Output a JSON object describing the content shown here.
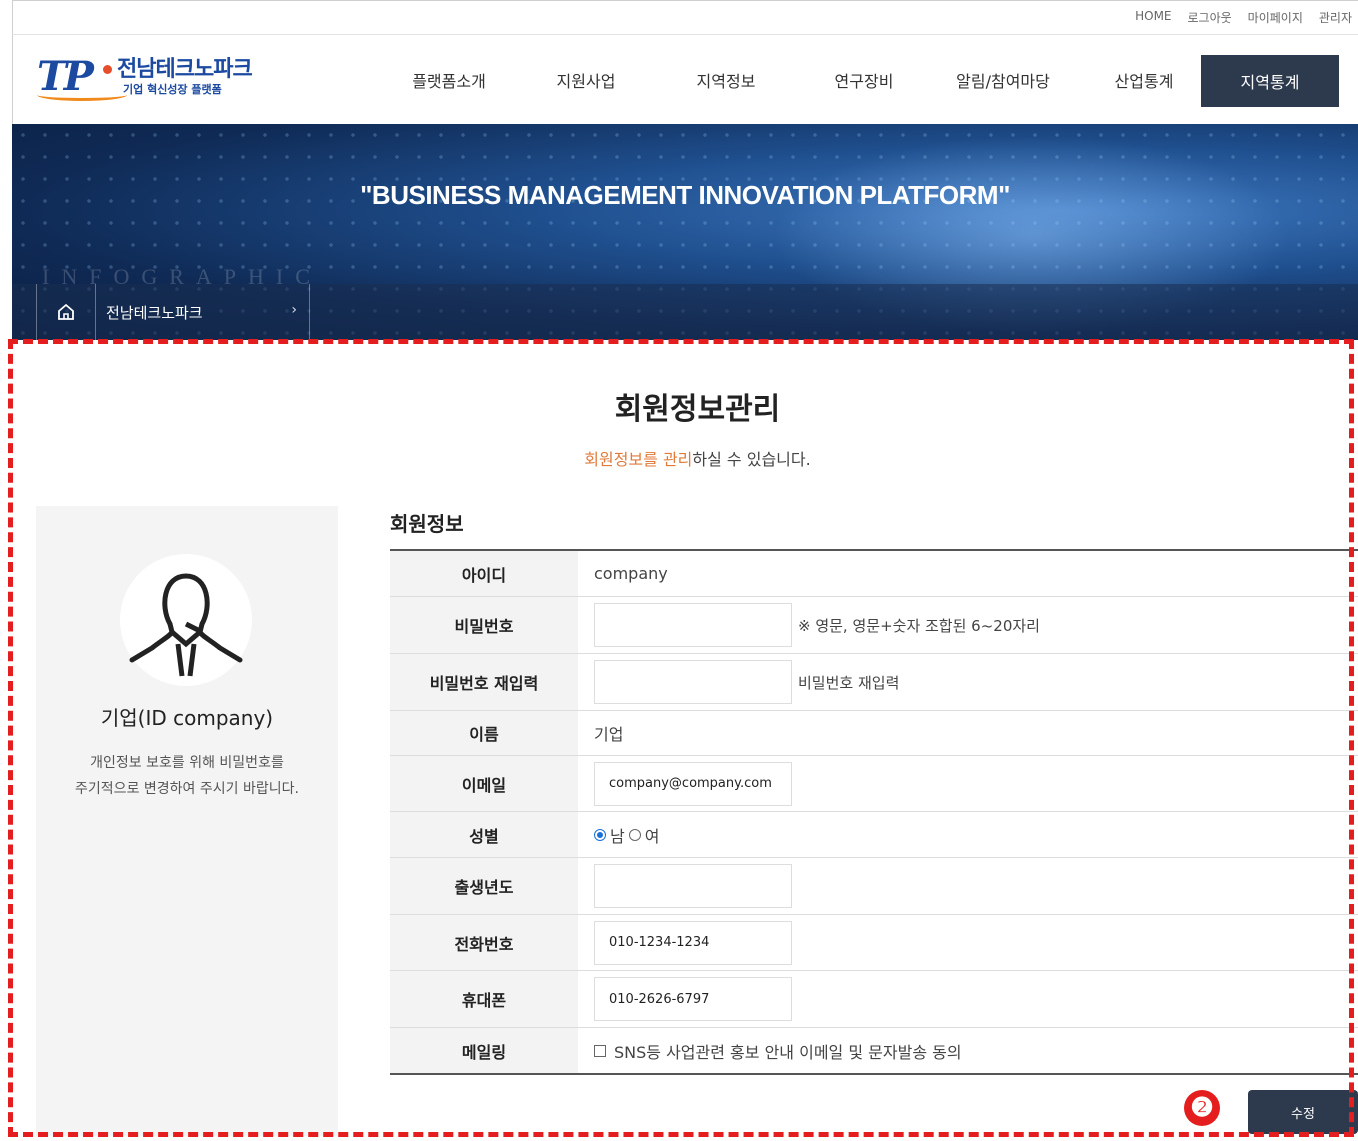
{
  "util_links": [
    "HOME",
    "로그아웃",
    "마이페이지",
    "관리자"
  ],
  "logo": {
    "mark": "TP",
    "title": "전남테크노파크",
    "subtitle": "기업 혁신성장 플랫폼"
  },
  "gnb": {
    "items": [
      "플랫폼소개",
      "지원사업",
      "지역정보",
      "연구장비",
      "알림/참여마당",
      "산업통계"
    ],
    "active": "지역통계"
  },
  "banner": {
    "slogan": "\"BUSINESS MANAGEMENT INNOVATION PLATFORM\"",
    "watermark": "INFOGRAPHIC"
  },
  "breadcrumb": {
    "item": "전남테크노파크"
  },
  "page": {
    "title": "회원정보관리",
    "desc_accent": "회원정보를 관리",
    "desc_rest": "하실 수 있습니다."
  },
  "profile": {
    "name": "기업(ID company)",
    "note_line1": "개인정보 보호를 위해 비밀번호를",
    "note_line2": "주기적으로 변경하여 주시기 바랍니다."
  },
  "form": {
    "section_title": "회원정보",
    "id_label": "아이디",
    "id_value": "company",
    "password_label": "비밀번호",
    "password_hint": "※ 영문, 영문+숫자 조합된 6~20자리",
    "password_confirm_label": "비밀번호 재입력",
    "password_confirm_hint": "비밀번호 재입력",
    "name_label": "이름",
    "name_value": "기업",
    "email_label": "이메일",
    "email_value": "company@company.com",
    "gender_label": "성별",
    "gender_male": "남",
    "gender_female": "여",
    "birth_label": "출생년도",
    "phone_label": "전화번호",
    "phone_value": "010-1234-1234",
    "mobile_label": "휴대폰",
    "mobile_value": "010-2626-6797",
    "mailing_label": "메일링",
    "mailing_text": "SNS등 사업관련 홍보 안내 이메일 및 문자발송 동의"
  },
  "submit_label": "수정",
  "step_badge": "❷"
}
